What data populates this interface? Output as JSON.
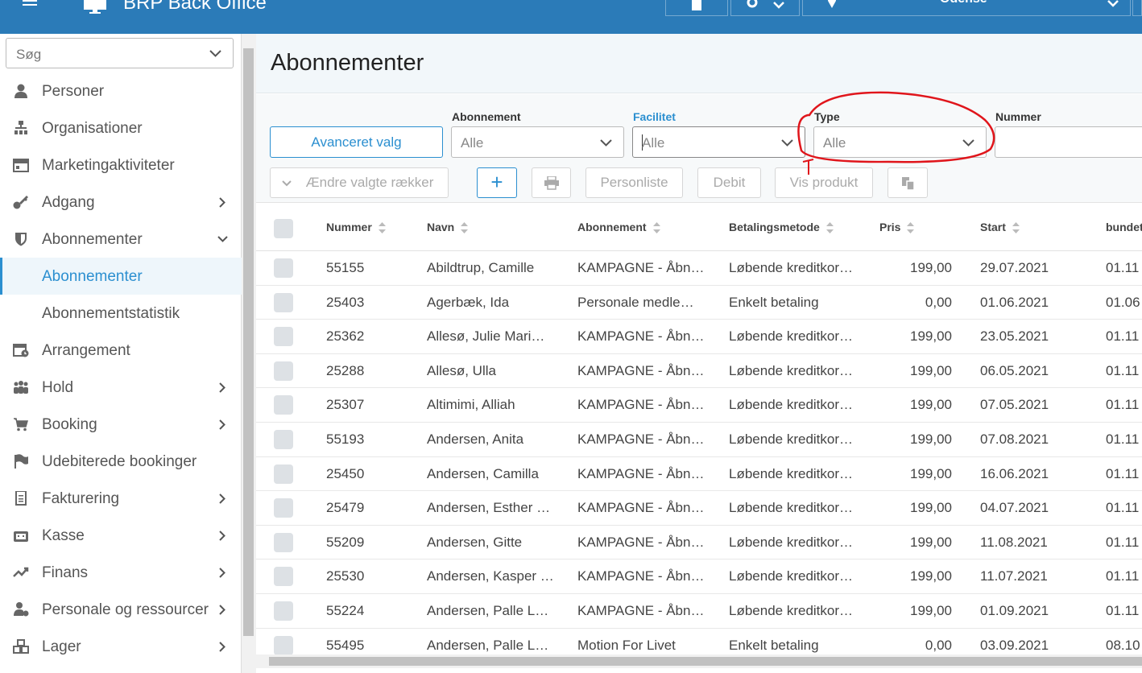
{
  "app": {
    "title": "BRP Back Office",
    "location": "Odense"
  },
  "sidebar": {
    "search_placeholder": "Søg",
    "items": [
      {
        "label": "Personer",
        "icon": "person-icon"
      },
      {
        "label": "Organisationer",
        "icon": "org-chart-icon"
      },
      {
        "label": "Marketingaktiviteter",
        "icon": "calendar-icon"
      },
      {
        "label": "Adgang",
        "icon": "key-icon"
      },
      {
        "label": "Abonnementer",
        "icon": "shield-icon"
      },
      {
        "label": "Abonnementer"
      },
      {
        "label": "Abonnementstatistik"
      },
      {
        "label": "Arrangement",
        "icon": "calendar-clock-icon"
      },
      {
        "label": "Hold",
        "icon": "group-icon"
      },
      {
        "label": "Booking",
        "icon": "cart-icon"
      },
      {
        "label": "Udebiterede bookinger",
        "icon": "flag-icon"
      },
      {
        "label": "Fakturering",
        "icon": "invoice-icon"
      },
      {
        "label": "Kasse",
        "icon": "cash-register-icon"
      },
      {
        "label": "Finans",
        "icon": "trend-icon"
      },
      {
        "label": "Personale og ressourcer",
        "icon": "staff-icon"
      },
      {
        "label": "Lager",
        "icon": "boxes-icon"
      }
    ]
  },
  "main": {
    "title": "Abonnementer",
    "advanced_button": "Avanceret valg",
    "filters": [
      {
        "label": "Abonnement",
        "value": "Alle"
      },
      {
        "label": "Facilitet",
        "value": "Alle"
      },
      {
        "label": "Type",
        "value": "Alle"
      },
      {
        "label": "Nummer",
        "value": ""
      }
    ],
    "toolbar": {
      "change_rows": "Ændre valgte rækker",
      "add": "+",
      "person_list": "Personliste",
      "debit": "Debit",
      "show_product": "Vis produkt"
    },
    "table": {
      "columns": [
        "Nummer",
        "Navn",
        "Abonnement",
        "Betalingsmetode",
        "Pris",
        "Start",
        "bundet"
      ],
      "rows": [
        [
          "55155",
          "Abildtrup, Camille",
          "KAMPAGNE - Åbn…",
          "Løbende kreditkor…",
          "199,00",
          "29.07.2021",
          "01.11"
        ],
        [
          "25403",
          "Agerbæk, Ida",
          "Personale medle…",
          "Enkelt betaling",
          "0,00",
          "01.06.2021",
          "01.06"
        ],
        [
          "25362",
          "Allesø, Julie Mari…",
          "KAMPAGNE - Åbn…",
          "Løbende kreditkor…",
          "199,00",
          "23.05.2021",
          "01.11"
        ],
        [
          "25288",
          "Allesø, Ulla",
          "KAMPAGNE - Åbn…",
          "Løbende kreditkor…",
          "199,00",
          "06.05.2021",
          "01.11"
        ],
        [
          "25307",
          "Altimimi, Alliah",
          "KAMPAGNE - Åbn…",
          "Løbende kreditkor…",
          "199,00",
          "07.05.2021",
          "01.11"
        ],
        [
          "55193",
          "Andersen, Anita",
          "KAMPAGNE - Åbn…",
          "Løbende kreditkor…",
          "199,00",
          "07.08.2021",
          "01.11"
        ],
        [
          "25450",
          "Andersen, Camilla",
          "KAMPAGNE - Åbn…",
          "Løbende kreditkor…",
          "199,00",
          "16.06.2021",
          "01.11"
        ],
        [
          "25479",
          "Andersen, Esther …",
          "KAMPAGNE - Åbn…",
          "Løbende kreditkor…",
          "199,00",
          "04.07.2021",
          "01.11"
        ],
        [
          "55209",
          "Andersen, Gitte",
          "KAMPAGNE - Åbn…",
          "Løbende kreditkor…",
          "199,00",
          "11.08.2021",
          "01.11"
        ],
        [
          "25530",
          "Andersen, Kasper …",
          "KAMPAGNE - Åbn…",
          "Løbende kreditkor…",
          "199,00",
          "11.07.2021",
          "01.11"
        ],
        [
          "55224",
          "Andersen, Palle L…",
          "KAMPAGNE - Åbn…",
          "Løbende kreditkor…",
          "199,00",
          "01.09.2021",
          "01.11"
        ],
        [
          "55495",
          "Andersen, Palle L…",
          "Motion For Livet",
          "Enkelt betaling",
          "0,00",
          "03.09.2021",
          "08.10"
        ]
      ]
    }
  },
  "colors": {
    "topbar": "#2b7bb8",
    "accent": "#2b8fd0",
    "annotation": "#e0151b"
  }
}
